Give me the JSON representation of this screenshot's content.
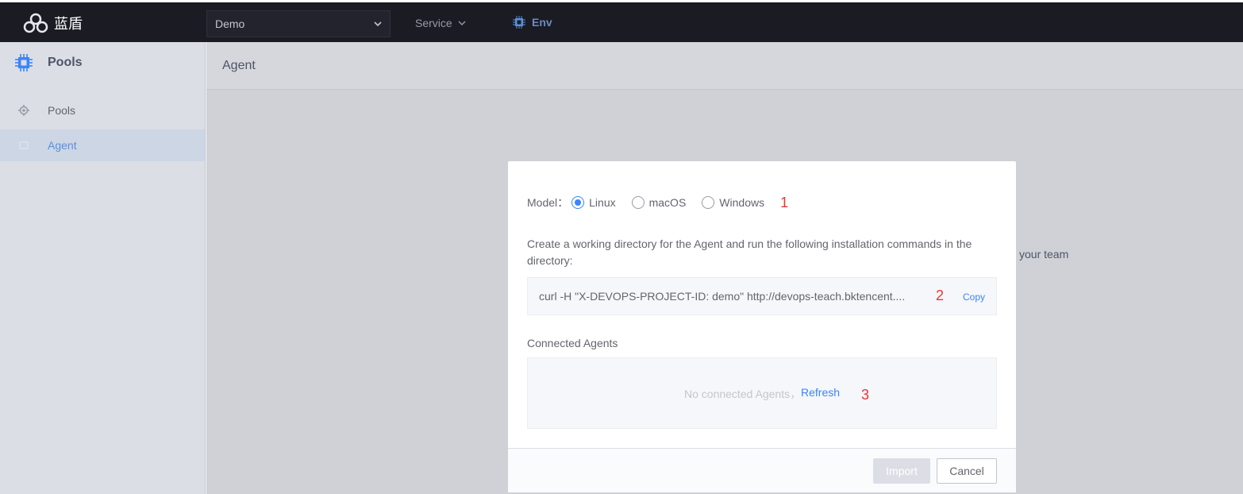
{
  "topbar": {
    "brand": "蓝盾",
    "project": "Demo",
    "service": "Service",
    "env": "Env"
  },
  "sidebar": {
    "title": "Pools",
    "items": [
      {
        "label": "Pools",
        "active": false
      },
      {
        "label": "Agent",
        "active": true
      }
    ]
  },
  "main": {
    "header": "Agent",
    "background_text": "your team"
  },
  "modal": {
    "model_label": "Model：",
    "os_options": [
      {
        "label": "Linux",
        "checked": true
      },
      {
        "label": "macOS",
        "checked": false
      },
      {
        "label": "Windows",
        "checked": false
      }
    ],
    "marker_1": "1",
    "instruction": "Create a working directory for the Agent and run the following installation commands in the directory:",
    "command": "curl -H \"X-DEVOPS-PROJECT-ID: demo\" http://devops-teach.bktencent....",
    "marker_2": "2",
    "copy_label": "Copy",
    "connected_title": "Connected Agents",
    "empty_text": "No connected Agents，",
    "refresh_label": "Refresh",
    "marker_3": "3",
    "import_label": "Import",
    "cancel_label": "Cancel"
  },
  "colors": {
    "primary": "#3a84ff",
    "marker": "#ea3636",
    "topbar": "#1a1b23"
  }
}
